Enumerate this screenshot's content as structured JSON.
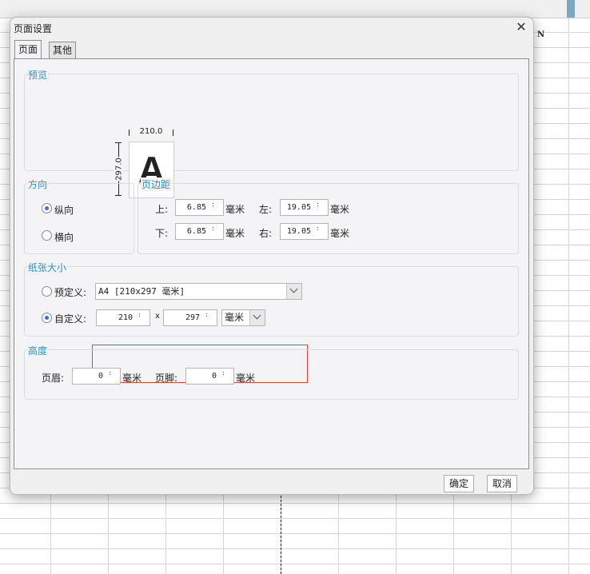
{
  "background": {
    "column_header": "N"
  },
  "dialog": {
    "title": "页面设置",
    "close_symbol": "✕",
    "tabs": [
      {
        "label": "页面",
        "active": true
      },
      {
        "label": "其他",
        "active": false
      }
    ],
    "preview": {
      "group_title": "预览",
      "width_label": "210.0",
      "height_label": "297.0",
      "sample_letter": "A"
    },
    "orientation": {
      "group_title": "方向",
      "portrait_label": "纵向",
      "landscape_label": "横向",
      "selected": "portrait"
    },
    "margins": {
      "group_title": "页边距",
      "top_label": "上:",
      "top_value": "6.85",
      "left_label": "左:",
      "left_value": "19.05",
      "bottom_label": "下:",
      "bottom_value": "6.85",
      "right_label": "右:",
      "right_value": "19.05",
      "unit": "毫米"
    },
    "paper_size": {
      "group_title": "纸张大小",
      "preset_label": "预定义:",
      "preset_value": "A4 [210x297 毫米]",
      "custom_label": "自定义:",
      "custom_width": "210",
      "separator": "x",
      "custom_height": "297",
      "unit_value": "毫米",
      "selected": "custom"
    },
    "height": {
      "group_title": "高度",
      "header_label": "页眉:",
      "header_value": "0",
      "footer_label": "页脚:",
      "footer_value": "0",
      "unit": "毫米"
    },
    "buttons": {
      "ok": "确定",
      "cancel": "取消"
    }
  },
  "colors": {
    "group_title": "#2f8fc4",
    "highlight_box": "#d9453b",
    "radio_dot": "#3a6fd8"
  }
}
